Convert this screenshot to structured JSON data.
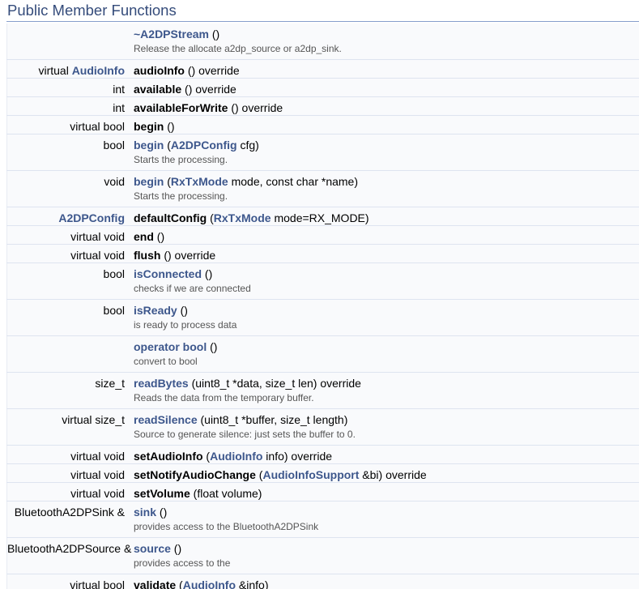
{
  "section": {
    "title": "Public Member Functions"
  },
  "members": [
    {
      "ret_prefix": "",
      "ret_link": "",
      "ret_suffix": "",
      "name": "~A2DPStream",
      "name_is_link": true,
      "sig": [
        {
          "t": " ()",
          "link": false
        }
      ],
      "desc": "Release the allocate a2dp_source or a2dp_sink."
    },
    {
      "ret_prefix": "virtual ",
      "ret_link": "AudioInfo",
      "ret_suffix": "",
      "name": "audioInfo",
      "name_is_link": false,
      "sig": [
        {
          "t": " () override",
          "link": false
        }
      ],
      "desc": ""
    },
    {
      "ret_prefix": "int",
      "ret_link": "",
      "ret_suffix": "",
      "name": "available",
      "name_is_link": false,
      "sig": [
        {
          "t": " () override",
          "link": false
        }
      ],
      "desc": ""
    },
    {
      "ret_prefix": "int",
      "ret_link": "",
      "ret_suffix": "",
      "name": "availableForWrite",
      "name_is_link": false,
      "sig": [
        {
          "t": " () override",
          "link": false
        }
      ],
      "desc": ""
    },
    {
      "ret_prefix": "virtual bool",
      "ret_link": "",
      "ret_suffix": "",
      "name": "begin",
      "name_is_link": false,
      "sig": [
        {
          "t": " ()",
          "link": false
        }
      ],
      "desc": ""
    },
    {
      "ret_prefix": "bool",
      "ret_link": "",
      "ret_suffix": "",
      "name": "begin",
      "name_is_link": true,
      "sig": [
        {
          "t": " (",
          "link": false
        },
        {
          "t": "A2DPConfig",
          "link": true
        },
        {
          "t": " cfg)",
          "link": false
        }
      ],
      "desc": "Starts the processing."
    },
    {
      "ret_prefix": "void",
      "ret_link": "",
      "ret_suffix": "",
      "name": "begin",
      "name_is_link": true,
      "sig": [
        {
          "t": " (",
          "link": false
        },
        {
          "t": "RxTxMode",
          "link": true
        },
        {
          "t": " mode, const char *name)",
          "link": false
        }
      ],
      "desc": "Starts the processing."
    },
    {
      "ret_prefix": "",
      "ret_link": "A2DPConfig",
      "ret_suffix": "",
      "name": "defaultConfig",
      "name_is_link": false,
      "sig": [
        {
          "t": " (",
          "link": false
        },
        {
          "t": "RxTxMode",
          "link": true
        },
        {
          "t": " mode=RX_MODE)",
          "link": false
        }
      ],
      "desc": ""
    },
    {
      "ret_prefix": "virtual void",
      "ret_link": "",
      "ret_suffix": "",
      "name": "end",
      "name_is_link": false,
      "sig": [
        {
          "t": " ()",
          "link": false
        }
      ],
      "desc": ""
    },
    {
      "ret_prefix": "virtual void",
      "ret_link": "",
      "ret_suffix": "",
      "name": "flush",
      "name_is_link": false,
      "sig": [
        {
          "t": " () override",
          "link": false
        }
      ],
      "desc": ""
    },
    {
      "ret_prefix": "bool",
      "ret_link": "",
      "ret_suffix": "",
      "name": "isConnected",
      "name_is_link": true,
      "sig": [
        {
          "t": " ()",
          "link": false
        }
      ],
      "desc": "checks if we are connected"
    },
    {
      "ret_prefix": "bool",
      "ret_link": "",
      "ret_suffix": "",
      "name": "isReady",
      "name_is_link": true,
      "sig": [
        {
          "t": " ()",
          "link": false
        }
      ],
      "desc": "is ready to process data"
    },
    {
      "ret_prefix": "",
      "ret_link": "",
      "ret_suffix": "",
      "name": "operator bool",
      "name_is_link": true,
      "sig": [
        {
          "t": " ()",
          "link": false
        }
      ],
      "desc": "convert to bool"
    },
    {
      "ret_prefix": "size_t",
      "ret_link": "",
      "ret_suffix": "",
      "name": "readBytes",
      "name_is_link": true,
      "sig": [
        {
          "t": " (uint8_t *data, size_t len) override",
          "link": false
        }
      ],
      "desc": "Reads the data from the temporary buffer."
    },
    {
      "ret_prefix": "virtual size_t",
      "ret_link": "",
      "ret_suffix": "",
      "name": "readSilence",
      "name_is_link": true,
      "sig": [
        {
          "t": " (uint8_t *buffer, size_t length)",
          "link": false
        }
      ],
      "desc": "Source to generate silence: just sets the buffer to 0."
    },
    {
      "ret_prefix": "virtual void",
      "ret_link": "",
      "ret_suffix": "",
      "name": "setAudioInfo",
      "name_is_link": false,
      "sig": [
        {
          "t": " (",
          "link": false
        },
        {
          "t": "AudioInfo",
          "link": true
        },
        {
          "t": " info) override",
          "link": false
        }
      ],
      "desc": ""
    },
    {
      "ret_prefix": "virtual void",
      "ret_link": "",
      "ret_suffix": "",
      "name": "setNotifyAudioChange",
      "name_is_link": false,
      "sig": [
        {
          "t": " (",
          "link": false
        },
        {
          "t": "AudioInfoSupport",
          "link": true
        },
        {
          "t": " &bi) override",
          "link": false
        }
      ],
      "desc": ""
    },
    {
      "ret_prefix": "virtual void",
      "ret_link": "",
      "ret_suffix": "",
      "name": "setVolume",
      "name_is_link": false,
      "sig": [
        {
          "t": " (float volume)",
          "link": false
        }
      ],
      "desc": ""
    },
    {
      "ret_prefix": "BluetoothA2DPSink &",
      "ret_link": "",
      "ret_suffix": "",
      "name": "sink",
      "name_is_link": true,
      "sig": [
        {
          "t": " ()",
          "link": false
        }
      ],
      "desc": "provides access to the BluetoothA2DPSink"
    },
    {
      "ret_prefix": "BluetoothA2DPSource &",
      "ret_link": "",
      "ret_suffix": "",
      "name": "source",
      "name_is_link": true,
      "sig": [
        {
          "t": " ()",
          "link": false
        }
      ],
      "desc": "provides access to the"
    },
    {
      "ret_prefix": "virtual bool",
      "ret_link": "",
      "ret_suffix": "",
      "name": "validate",
      "name_is_link": false,
      "sig": [
        {
          "t": " (",
          "link": false
        },
        {
          "t": "AudioInfo",
          "link": true
        },
        {
          "t": " &info)",
          "link": false
        }
      ],
      "desc": ""
    }
  ],
  "colors": {
    "link": "#3d578c",
    "title": "#354c7b",
    "rule": "#879ecb",
    "row_bg": "#f9fafc",
    "row_border": "#dee4f0",
    "desc_text": "#555555"
  }
}
